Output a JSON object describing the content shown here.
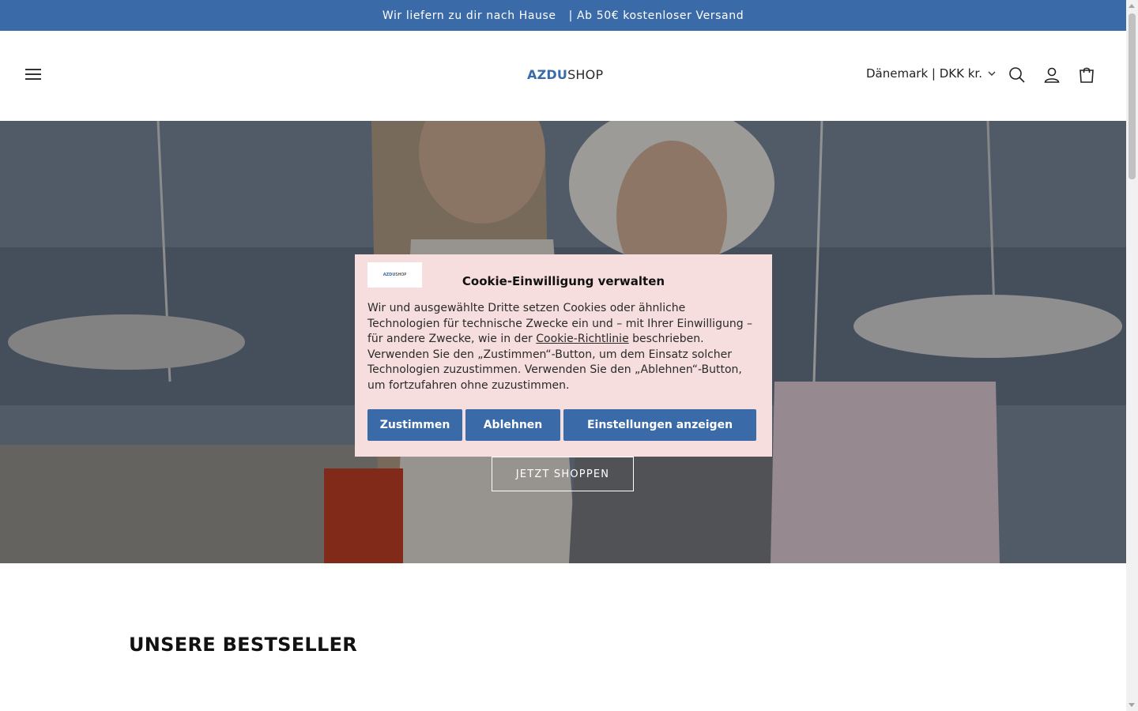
{
  "announcement": {
    "part1": "Wir liefern zu dir nach Hause",
    "part2": "| Ab 50€ kostenloser Versand"
  },
  "header": {
    "logo_part1": "AZDU",
    "logo_part2": "SHOP",
    "country_selector": "Dänemark | DKK kr.",
    "icons": [
      "menu-icon",
      "search-icon",
      "account-icon",
      "cart-icon"
    ]
  },
  "hero": {
    "button_label": "JETZT SHOPPEN"
  },
  "section": {
    "title": "UNSERE BESTSELLER"
  },
  "cookie": {
    "title": "Cookie-Einwilligung verwalten",
    "text_before_link": "Wir und ausgewählte Dritte setzen Cookies oder ähnliche Technologien für technische Zwecke ein und – mit Ihrer Einwilligung – für andere Zwecke, wie in der ",
    "link_text": "Cookie-Richtlinie",
    "text_after_link": " beschrieben. Verwenden Sie den „Zustimmen“-Button, um dem Einsatz solcher Technologien zuzustimmen. Verwenden Sie den „Ablehnen“-Button, um fortzufahren ohne zuzustimmen.",
    "accept": "Zustimmen",
    "reject": "Ablehnen",
    "settings": "Einstellungen anzeigen"
  },
  "colors": {
    "brand": "#3a6ba8",
    "cookie_bg": "#f7dede"
  }
}
